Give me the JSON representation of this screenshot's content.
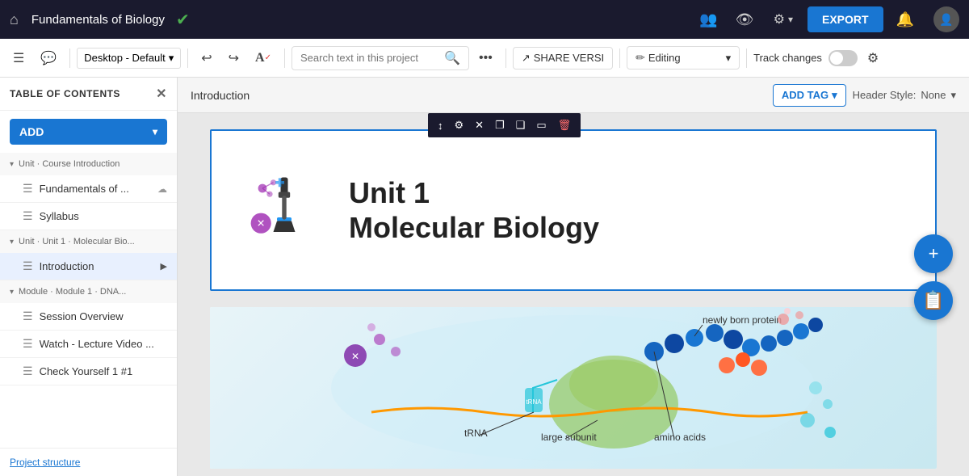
{
  "topnav": {
    "home_icon": "⌂",
    "project_title": "Fundamentals of Biology",
    "check_icon": "✓",
    "export_label": "EXPORT",
    "nav_icons": [
      "👥",
      "👁",
      "⚙"
    ]
  },
  "toolbar": {
    "layout_icon": "☰",
    "comment_icon": "💬",
    "desktop_label": "Desktop - Default",
    "undo_icon": "↩",
    "redo_icon": "↪",
    "spell_icon": "A",
    "search_placeholder": "Search text in this project",
    "more_icon": "•••",
    "share_label": "SHARE VERSI",
    "editing_label": "Editing",
    "track_changes_label": "Track changes",
    "settings_icon": "⚙"
  },
  "sidebar": {
    "title": "TABLE OF CONTENTS",
    "add_label": "ADD",
    "items": [
      {
        "type": "unit",
        "label": "Unit  · Course Introduction",
        "expanded": true
      },
      {
        "type": "page",
        "label": "Fundamentals of ...",
        "has_action": true
      },
      {
        "type": "page",
        "label": "Syllabus",
        "has_action": false
      },
      {
        "type": "unit",
        "label": "Unit  · Unit 1 · Molecular Bio...",
        "expanded": true
      },
      {
        "type": "page",
        "label": "Introduction",
        "active": true,
        "has_action": false
      },
      {
        "type": "module",
        "label": "Module  · Module 1 · DNA...",
        "expanded": true
      },
      {
        "type": "page",
        "label": "Session Overview",
        "has_action": false
      },
      {
        "type": "page",
        "label": "Watch - Lecture Video ...",
        "has_action": false
      },
      {
        "type": "page",
        "label": "Check Yourself 1 #1",
        "has_action": false
      }
    ],
    "project_structure": "Project structure"
  },
  "content": {
    "breadcrumb": "Introduction",
    "add_tag_label": "ADD TAG",
    "header_style_label": "Header Style:",
    "header_style_value": "None",
    "block_tools": [
      "⬆",
      "⚙",
      "✕",
      "❐",
      "❑",
      "▭",
      "🗑"
    ],
    "unit_title_line1": "Unit 1",
    "unit_title_line2": "Molecular Biology",
    "dna_labels": [
      "newly born protein",
      "amino acids",
      "large subunit",
      "tRNA"
    ]
  },
  "fabs": {
    "plus_icon": "+",
    "clipboard_icon": "📋"
  }
}
